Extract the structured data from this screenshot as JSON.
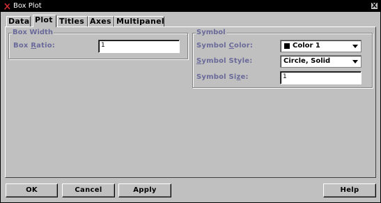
{
  "window": {
    "title": "Box Plot",
    "close_label": "X",
    "icon": "app-icon"
  },
  "tabs": [
    {
      "label": "Data",
      "active": false
    },
    {
      "label": "Plot",
      "active": true
    },
    {
      "label": "Titles",
      "active": false
    },
    {
      "label": "Axes",
      "active": false
    },
    {
      "label": "Multipanel",
      "active": false
    }
  ],
  "box_width": {
    "title": "Box Width",
    "ratio_label_pre": "Box ",
    "ratio_label_mnemonic": "R",
    "ratio_label_post": "atio:",
    "ratio_value": "1"
  },
  "symbol": {
    "title": "Symbol",
    "color_label_pre": "Symbol ",
    "color_label_mnemonic": "C",
    "color_label_post": "olor:",
    "color_value": "Color 1",
    "color_swatch": "#000000",
    "style_label_pre": "",
    "style_label_mnemonic": "S",
    "style_label_post": "ymbol Style:",
    "style_value": "Circle, Solid",
    "size_label_pre": "Symbol Si",
    "size_label_mnemonic": "z",
    "size_label_post": "e:",
    "size_value": "1"
  },
  "buttons": {
    "ok": "OK",
    "cancel": "Cancel",
    "apply": "Apply",
    "help": "Help"
  },
  "colors": {
    "titlebar_bg": "#000000",
    "face": "#c0c0c0",
    "label_text": "#6a6a9a"
  }
}
